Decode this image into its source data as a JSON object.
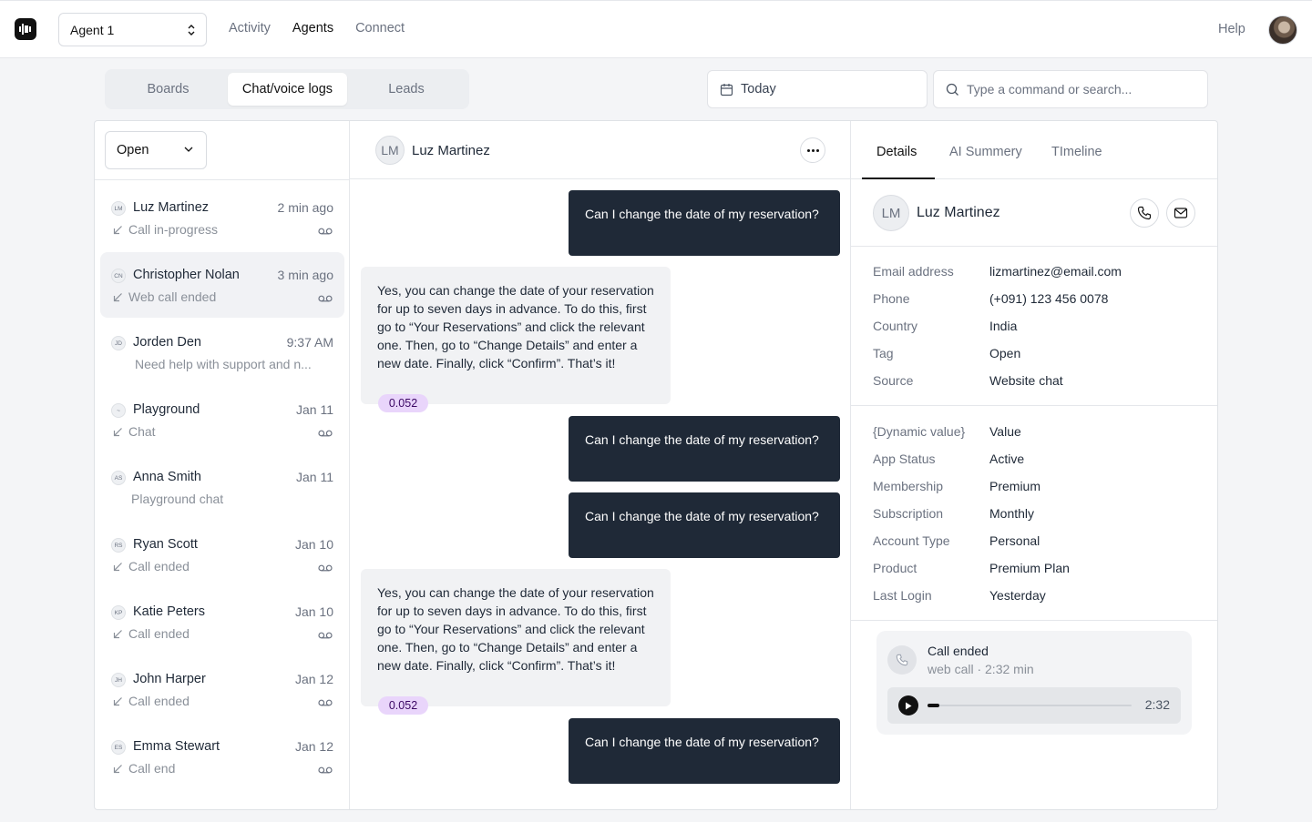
{
  "topbar": {
    "agent_select": "Agent 1",
    "nav": [
      "Activity",
      "Agents",
      "Connect"
    ],
    "nav_active": 1,
    "help": "Help"
  },
  "tabs": {
    "items": [
      "Boards",
      "Chat/voice logs",
      "Leads"
    ],
    "active": 1
  },
  "date_filter": "Today",
  "search": {
    "placeholder": "Type a command or search..."
  },
  "list": {
    "filter": "Open",
    "items": [
      {
        "initials": "LM",
        "name": "Luz Martinez",
        "time": "2 min ago",
        "sub": "Call in-progress",
        "icon": "call-arrow-icon",
        "voicemail": true
      },
      {
        "initials": "CN",
        "name": "Christopher Nolan",
        "time": "3 min ago",
        "sub": "Web call ended",
        "icon": "call-arrow-icon",
        "voicemail": true
      },
      {
        "initials": "JD",
        "name": "Jorden Den",
        "time": "9:37 AM",
        "sub": "Need help with support and n...",
        "icon": "",
        "voicemail": false
      },
      {
        "initials": "~",
        "name": "Playground",
        "time": "Jan 11",
        "sub": "Chat",
        "icon": "call-arrow-icon",
        "voicemail": true
      },
      {
        "initials": "AS",
        "name": "Anna Smith",
        "time": "Jan 11",
        "sub": "Playground chat",
        "icon": "",
        "voicemail": false
      },
      {
        "initials": "RS",
        "name": "Ryan Scott",
        "time": "Jan 10",
        "sub": "Call ended",
        "icon": "call-arrow-icon",
        "voicemail": true
      },
      {
        "initials": "KP",
        "name": "Katie Peters",
        "time": "Jan 10",
        "sub": "Call ended",
        "icon": "call-arrow-icon",
        "voicemail": true
      },
      {
        "initials": "JH",
        "name": "John Harper",
        "time": "Jan 12",
        "sub": "Call ended",
        "icon": "call-arrow-icon",
        "voicemail": true
      },
      {
        "initials": "ES",
        "name": "Emma Stewart",
        "time": "Jan 12",
        "sub": "Call end",
        "icon": "call-arrow-icon",
        "voicemail": true
      }
    ],
    "selected": 1
  },
  "chat": {
    "contact_initials": "LM",
    "contact_name": "Luz Martinez",
    "messages": [
      {
        "dir": "out",
        "text": "Can I change the date of my reservation?"
      },
      {
        "dir": "in",
        "text": "Yes, you can change the date of your reservation for up to seven days in advance. To do this, first go to “Your Reservations” and click the relevant one. Then, go to “Change Details” and enter a new date. Finally, click “Confirm”. That’s it!",
        "score": "0.052"
      },
      {
        "dir": "out",
        "text": "Can I change the date of my reservation?"
      },
      {
        "dir": "out",
        "text": "Can I change the date of my reservation?"
      },
      {
        "dir": "in",
        "text": "Yes, you can change the date of your reservation for up to seven days in advance. To do this, first go to “Your Reservations” and click the relevant one. Then, go to “Change Details” and enter a new date. Finally, click “Confirm”. That’s it!",
        "score": "0.052"
      },
      {
        "dir": "out",
        "text": "Can I change the date of my reservation?"
      }
    ]
  },
  "details": {
    "tabs": [
      "Details",
      "AI Summery",
      "TImeline"
    ],
    "active_tab": 0,
    "initials": "LM",
    "name": "Luz Martinez",
    "fields": [
      {
        "k": "Email address",
        "v": "lizmartinez@email.com"
      },
      {
        "k": "Phone",
        "v": "(+091) 123 456 0078"
      },
      {
        "k": "Country",
        "v": "India"
      },
      {
        "k": "Tag",
        "v": "Open"
      },
      {
        "k": "Source",
        "v": "Website chat"
      }
    ],
    "custom_fields": [
      {
        "k": "{Dynamic value}",
        "v": "Value"
      },
      {
        "k": "App Status",
        "v": "Active"
      },
      {
        "k": "Membership",
        "v": "Premium"
      },
      {
        "k": "Subscription",
        "v": "Monthly"
      },
      {
        "k": "Account Type",
        "v": "Personal"
      },
      {
        "k": "Product",
        "v": "Premium Plan"
      },
      {
        "k": "Last Login",
        "v": "Yesterday"
      }
    ],
    "call": {
      "title": "Call ended",
      "subtitle": "web call · 2:32 min",
      "duration": "2:32",
      "progress": 0.06
    }
  }
}
